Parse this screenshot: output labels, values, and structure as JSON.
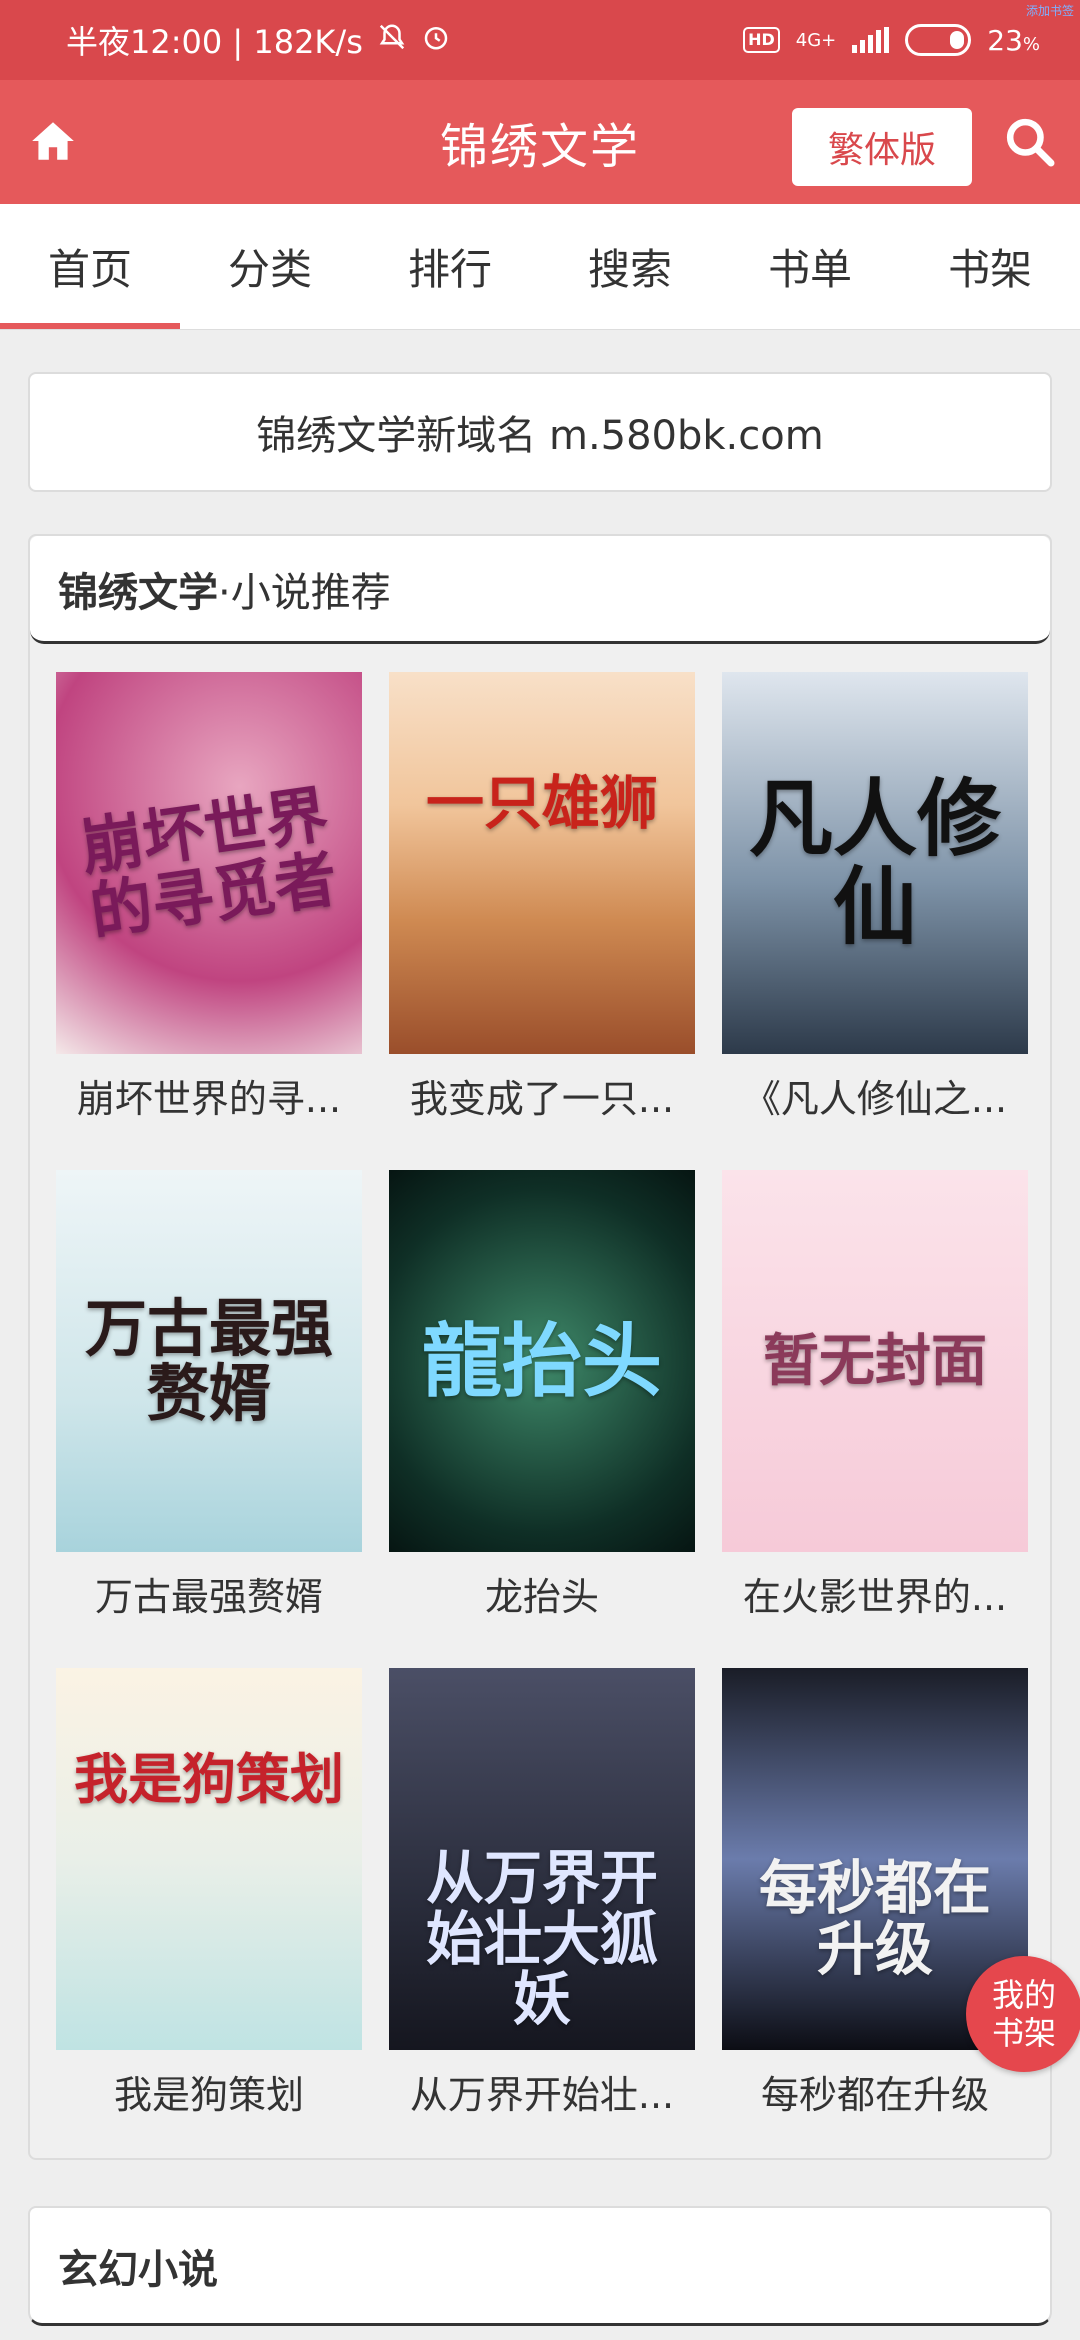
{
  "status_bar": {
    "time_speed": "半夜12:00 | 182K/s",
    "mute_icon": "bell-off-icon",
    "alarm_icon": "alarm-icon",
    "hd": "HD",
    "network": "4G+",
    "battery": "23",
    "battery_unit": "%",
    "corner_text": "添加书签"
  },
  "header": {
    "title": "锦绣文学",
    "traditional_button": "繁体版",
    "home_icon": "home-icon",
    "search_icon": "search-icon",
    "brand_color": "#e5595b"
  },
  "nav": {
    "tabs": [
      "首页",
      "分类",
      "排行",
      "搜索",
      "书单",
      "书架"
    ],
    "active_index": 0
  },
  "notice": "锦绣文学新域名 m.580bk.com",
  "recommend": {
    "title_bold": "锦绣文学",
    "title_rest": "·小说推荐",
    "books": [
      {
        "name": "崩坏世界的寻...",
        "cover_text": "崩坏世界的寻觅者"
      },
      {
        "name": "我变成了一只...",
        "cover_text": "一只雄狮"
      },
      {
        "name": "《凡人修仙之...",
        "cover_text": "凡人修仙"
      },
      {
        "name": "万古最强赘婿",
        "cover_text": "万古最强赘婿"
      },
      {
        "name": "龙抬头",
        "cover_text": "龍抬头"
      },
      {
        "name": "在火影世界的...",
        "cover_text": "暂无封面"
      },
      {
        "name": "我是狗策划",
        "cover_text": "我是狗策划"
      },
      {
        "name": "从万界开始壮...",
        "cover_text": "从万界开始壮大狐妖"
      },
      {
        "name": "每秒都在升级",
        "cover_text": "每秒都在升级"
      }
    ]
  },
  "float_button": "我的书架",
  "next_section": "玄幻小说"
}
